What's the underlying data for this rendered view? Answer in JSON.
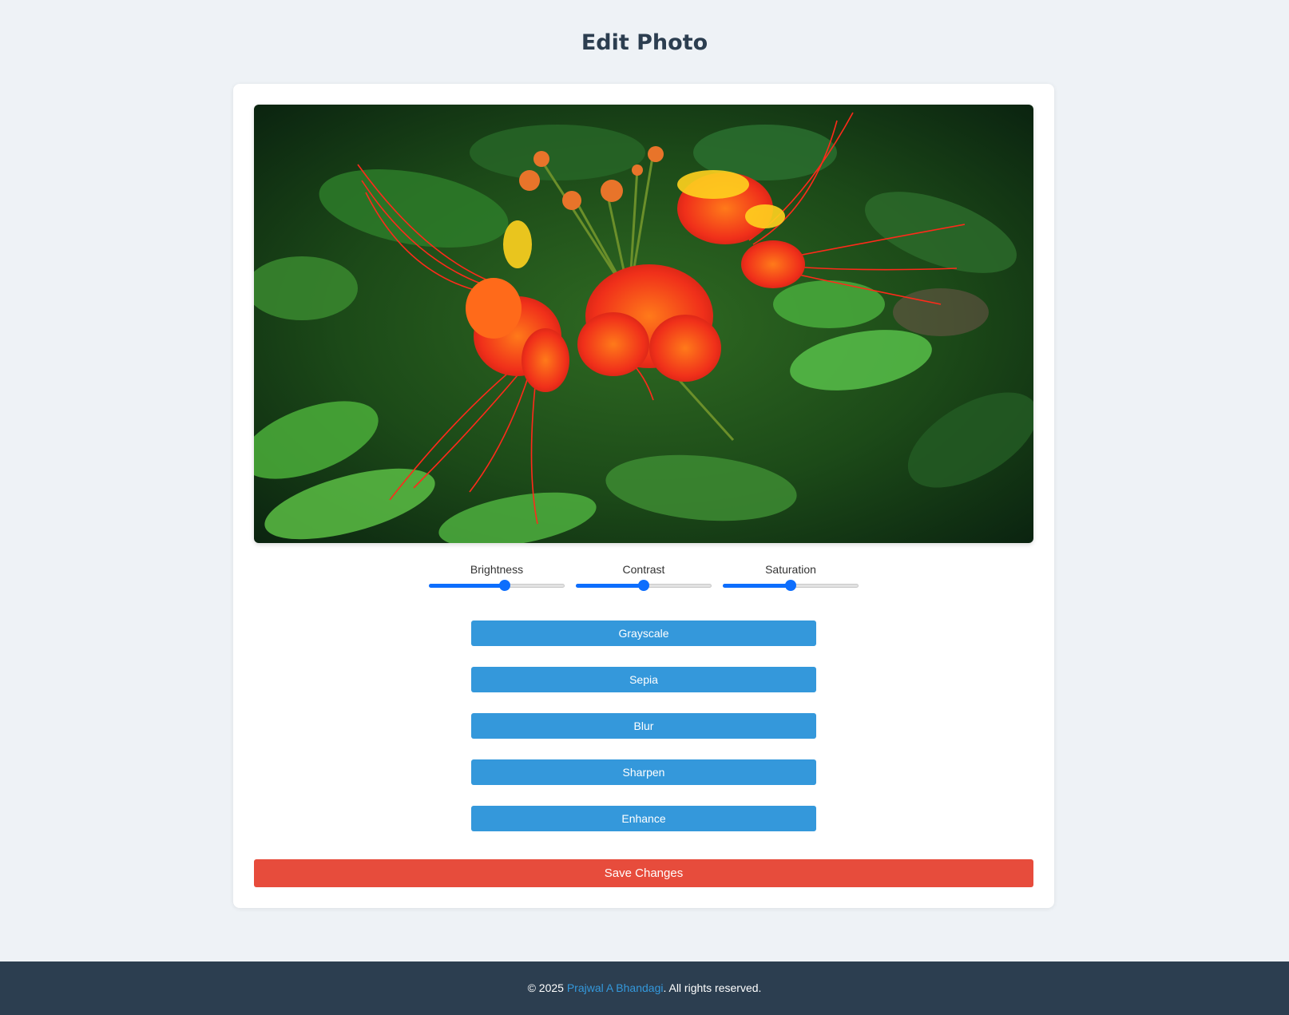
{
  "header": {
    "title": "Edit Photo"
  },
  "photo": {
    "description_icon": "flower-photo"
  },
  "adjustments": [
    {
      "label": "Brightness",
      "value": 0.56
    },
    {
      "label": "Contrast",
      "value": 0.5
    },
    {
      "label": "Saturation",
      "value": 0.5
    }
  ],
  "filters": {
    "grayscale": "Grayscale",
    "sepia": "Sepia",
    "blur": "Blur",
    "sharpen": "Sharpen",
    "enhance": "Enhance"
  },
  "actions": {
    "save_label": "Save Changes"
  },
  "footer": {
    "prefix": "© 2025 ",
    "author": "Prajwal A Bhandagi",
    "suffix": ". All rights reserved."
  },
  "colors": {
    "accent_blue": "#3498db",
    "slider_blue": "#0d6efd",
    "save_red": "#e74c3c",
    "footer_bg": "#2c3e50",
    "page_bg": "#eef2f6"
  }
}
